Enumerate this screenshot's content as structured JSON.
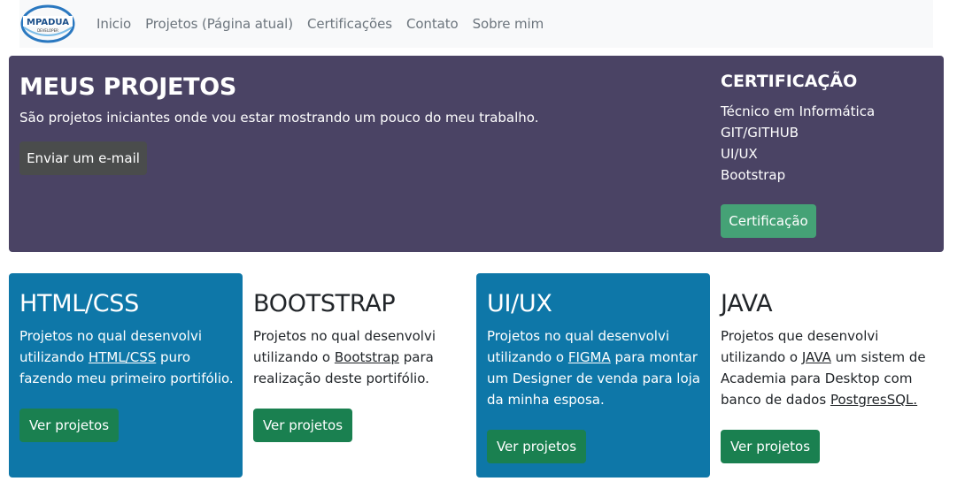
{
  "navbar": {
    "logo_text": "MPADUA",
    "logo_sub": "DEVELOPER",
    "links": [
      "Inicio",
      "Projetos (Página atual)",
      "Certificações",
      "Contato",
      "Sobre mim"
    ]
  },
  "hero": {
    "title": "MEUS PROJETOS",
    "subtitle": "São projetos iniciantes onde vou estar mostrando um pouco do meu trabalho.",
    "email_button": "Enviar um e-mail",
    "cert_title": "CERTIFICAÇÃO",
    "cert_items": [
      "Técnico em Informática",
      "GIT/GITHUB",
      "UI/UX",
      "Bootstrap"
    ],
    "cert_button": "Certificação"
  },
  "cards": [
    {
      "title": "HTML/CSS",
      "text_before": "Projetos no qual desenvolvi utilizando ",
      "link": "HTML/CSS",
      "text_middle": " puro fazendo meu primeiro portifólio.",
      "link2": "",
      "text_after": "",
      "button": "Ver projetos"
    },
    {
      "title": "BOOTSTRAP",
      "text_before": "Projetos no qual desenvolvi utilizando o ",
      "link": "Bootstrap",
      "text_middle": " para realização deste portifólio.",
      "link2": "",
      "text_after": "",
      "button": "Ver projetos"
    },
    {
      "title": "UI/UX",
      "text_before": "Projetos no qual desenvolvi utilizando o ",
      "link": "FIGMA",
      "text_middle": " para montar um Designer de venda para loja da minha esposa.",
      "link2": "",
      "text_after": "",
      "button": "Ver projetos"
    },
    {
      "title": "JAVA",
      "text_before": "Projetos que desenvolvi utilizando o ",
      "link": "JAVA",
      "text_middle": " um sistem de Academia para Desktop com banco de dados ",
      "link2": "PostgresSQL.",
      "text_after": "",
      "button": "Ver projetos"
    }
  ],
  "colors": {
    "hero_bg": "#4a4364",
    "card_blue": "#0e77a8",
    "button_green": "#1a8050",
    "cert_button": "#45a276",
    "email_button": "#4a4c4c"
  }
}
